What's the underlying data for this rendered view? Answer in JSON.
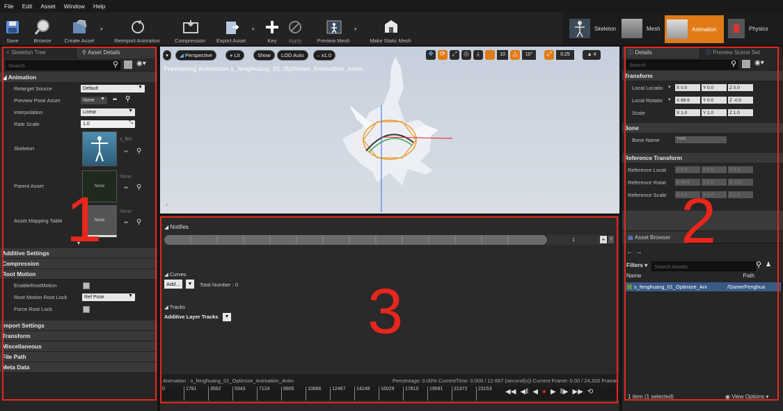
{
  "menu": [
    "File",
    "Edit",
    "Asset",
    "Window",
    "Help"
  ],
  "toolbar": {
    "save": "Save",
    "browse": "Browse",
    "create_asset": "Create Asset",
    "reimport": "Reimport Animation",
    "compression": "Compression",
    "export": "Export Asset",
    "key": "Key",
    "apply": "Apply",
    "preview_mesh": "Preview Mesh",
    "make_static_mesh": "Make Static Mesh"
  },
  "modes": {
    "skeleton": "Skeleton",
    "mesh": "Mesh",
    "animation": "Animation",
    "physics": "Physics"
  },
  "left": {
    "tab1": "Skeleton Tree",
    "tab2": "Asset Details",
    "search": "Search",
    "animation_cat": "Animation",
    "retarget_source": "Retarget Source",
    "retarget_val": "Default",
    "preview_pose": "Preview Pose Asset",
    "preview_pose_val": "None",
    "interpolation": "Interpolation",
    "interpolation_val": "Linear",
    "rate_scale": "Rate Scale",
    "rate_scale_val": "1.0",
    "skeleton": "Skeleton",
    "skeleton_val": "s_fen",
    "parent_asset": "Parent Asset",
    "parent_val": "None",
    "thumb_none": "None",
    "asset_mapping": "Asset Mapping Table",
    "mapping_val": "None",
    "additive": "Additive Settings",
    "compression": "Compression",
    "root_motion": "Root Motion",
    "enable_root": "EnableRootMotion",
    "root_lock": "Root Motion Root Lock",
    "root_lock_val": "Ref Pose",
    "force_root": "Force Root Lock",
    "import": "Import Settings",
    "transform": "Transform",
    "misc": "Miscellaneous",
    "file_path": "File Path",
    "meta": "Meta Data"
  },
  "viewport": {
    "perspective": "Perspective",
    "lit": "Lit",
    "show": "Show",
    "lod": "LOD Auto",
    "speed": "x1.0",
    "preview_text": "Previewing Animation s_fenghuang_01_Optimize_Animation_Anim",
    "grid1": "10",
    "grid2": "10°",
    "scale": "0.25",
    "cam": "4"
  },
  "timeline": {
    "notifies": "Notifies",
    "notify_track": "1",
    "curves": "Curves",
    "add": "Add...",
    "total": "Total Number : 0",
    "tracks": "Tracks",
    "additive_layer": "Additive Layer Tracks",
    "status_anim": "Animation : s_fenghuang_01_Optimize_Animation_Anim",
    "status_pct": "Percentage: 0.00% CurrentTime: 0.000 / 12.667 (second(s)) Current Frame: 0.00 / 24,320 Frame",
    "ticks": [
      "0",
      "1781",
      "3562",
      "5343",
      "7124",
      "8905",
      "10686",
      "12467",
      "14248",
      "16029",
      "17810",
      "19591",
      "21372",
      "23153"
    ]
  },
  "right": {
    "tab1": "Details",
    "tab2": "Preview Scene Set",
    "search": "Search",
    "transform": "Transform",
    "loc": "Local Locatio",
    "rot": "Local Rotatio",
    "scale": "Scale",
    "loc_v": [
      "X 0.0",
      "Y 0.0",
      "Z 0.0"
    ],
    "rot_v": [
      "X 89.9",
      "Y 0.0",
      "Z -0.0"
    ],
    "scale_v": [
      "X 1.0",
      "Y 1.0",
      "Z 1.0"
    ],
    "bone": "Bone",
    "bone_name": "Bone Name",
    "bone_val": "root",
    "ref_transform": "Reference Transform",
    "ref_loc": "Reference Locat",
    "ref_rot": "Reference Rotat",
    "ref_scale": "Reference Scale",
    "asset_browser": "Asset Browser",
    "filters": "Filters",
    "search_assets": "Search Assets",
    "col_name": "Name",
    "col_path": "Path",
    "item_name": "s_fenghuang_01_Optimize_Ani",
    "item_path": "/Game/Fenghua",
    "count": "1 item (1 selected)",
    "view_opts": "View Options"
  },
  "annotations": [
    "1",
    "2",
    "3"
  ],
  "colors": {
    "accent": "#e8261c",
    "orange": "#e07b16",
    "select": "#3a5a86"
  }
}
